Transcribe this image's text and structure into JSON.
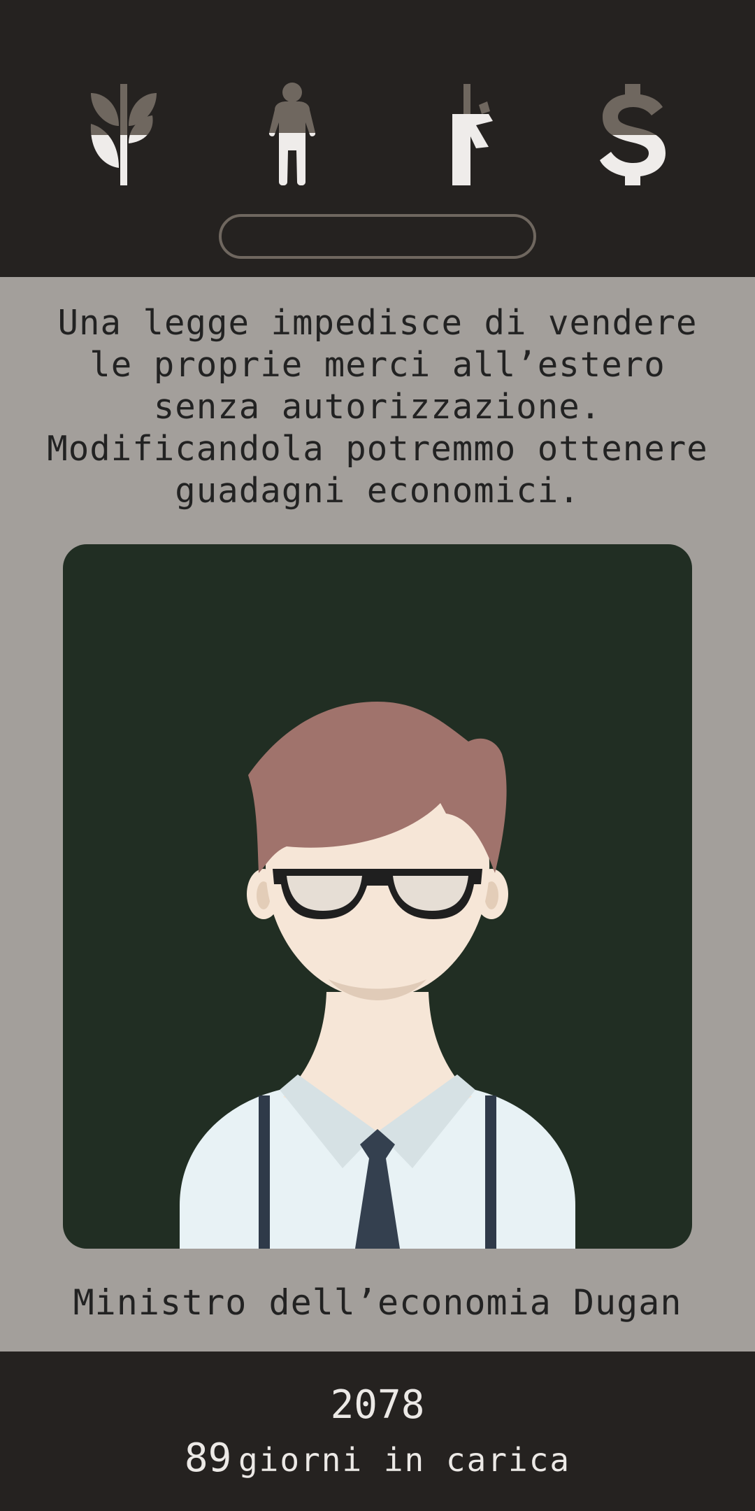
{
  "stats": [
    {
      "icon": "church-icon",
      "level": 0.5
    },
    {
      "icon": "people-icon",
      "level": 0.5
    },
    {
      "icon": "military-icon",
      "level": 0.7
    },
    {
      "icon": "money-icon",
      "level": 0.55
    }
  ],
  "card": {
    "question": "Una legge impedisce di vendere\nle proprie merci all’estero\nsenza autorizzazione.\nModificandola potremmo ottenere\nguadagni economici.",
    "character_name": "Ministro dell’economia Dugan"
  },
  "footer": {
    "year": "2078",
    "days_number": "89",
    "days_label": "giorni in carica"
  },
  "colors": {
    "top_bar": "#252220",
    "card_background": "#a39f9b",
    "portrait_background": "#212e23",
    "icon_filled": "#efecea",
    "icon_empty": "#6f675f"
  }
}
